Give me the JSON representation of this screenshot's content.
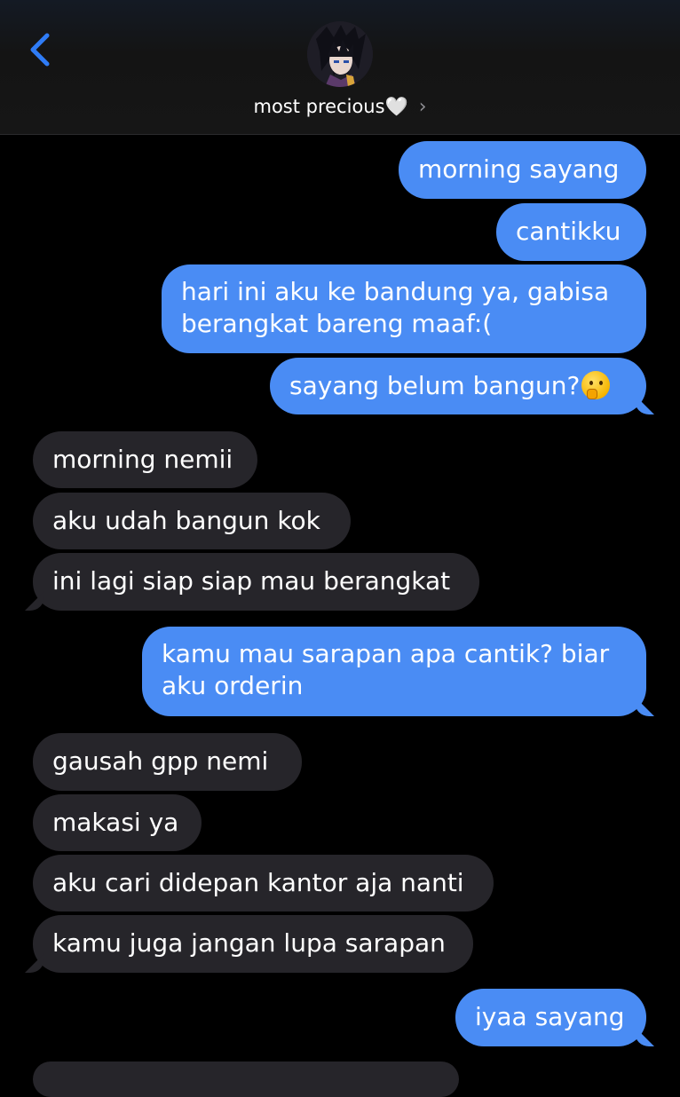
{
  "header": {
    "contact_name": "most precious🤍",
    "chevron": "›",
    "back_icon": "chevron-left-icon",
    "avatar_icon": "contact-avatar"
  },
  "colors": {
    "sent_bubble": "#4a8cf4",
    "received_bubble": "#26252a",
    "accent": "#2f7cf6",
    "background": "#000000"
  },
  "messages": [
    {
      "direction": "sent",
      "text": "morning sayang"
    },
    {
      "direction": "sent",
      "text": "cantikku"
    },
    {
      "direction": "sent",
      "line1": "hari ini aku ke bandung ya, gabisa",
      "line2": "berangkat bareng maaf:("
    },
    {
      "direction": "sent",
      "text": "sayang belum bangun?",
      "emoji": "thinking-face-emoji"
    },
    {
      "direction": "received",
      "text": "morning nemii"
    },
    {
      "direction": "received",
      "text": "aku udah bangun kok"
    },
    {
      "direction": "received",
      "text": "ini lagi siap siap mau berangkat"
    },
    {
      "direction": "sent",
      "line1": "kamu mau sarapan apa cantik? biar",
      "line2": "aku orderin"
    },
    {
      "direction": "received",
      "text": "gausah gpp nemi"
    },
    {
      "direction": "received",
      "text": "makasi ya"
    },
    {
      "direction": "received",
      "text": "aku cari didepan kantor aja nanti"
    },
    {
      "direction": "received",
      "text": "kamu juga jangan lupa sarapan"
    },
    {
      "direction": "sent",
      "text": "iyaa sayang"
    }
  ]
}
